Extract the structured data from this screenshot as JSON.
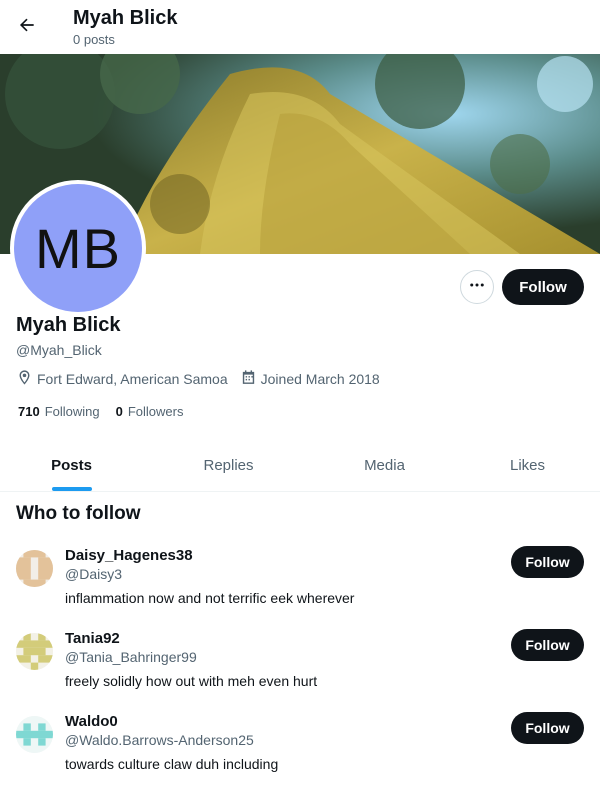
{
  "header": {
    "title": "Myah Blick",
    "post_count": "0 posts",
    "back_icon": "arrow-left-icon"
  },
  "profile": {
    "avatar_initials": "MB",
    "avatar_color": "#8fa0f8",
    "display_name": "Myah Blick",
    "handle": "@Myah_Blick",
    "location": "Fort Edward, American Samoa",
    "joined": "Joined March 2018",
    "following_count": "710",
    "following_label": "Following",
    "followers_count": "0",
    "followers_label": "Followers",
    "follow_label": "Follow"
  },
  "tabs": [
    {
      "label": "Posts",
      "active": true
    },
    {
      "label": "Replies",
      "active": false
    },
    {
      "label": "Media",
      "active": false
    },
    {
      "label": "Likes",
      "active": false
    }
  ],
  "who_to_follow": {
    "title": "Who to follow",
    "items": [
      {
        "name": "Daisy_Hagenes38",
        "handle": "@Daisy3",
        "bio": "inflammation now and not terrific eek wherever",
        "follow_label": "Follow",
        "avatar_color": "#e3c29a"
      },
      {
        "name": "Tania92",
        "handle": "@Tania_Bahringer99",
        "bio": "freely solidly how out with meh even hurt",
        "follow_label": "Follow",
        "avatar_color": "#d3cc7a"
      },
      {
        "name": "Waldo0",
        "handle": "@Waldo.Barrows-Anderson25",
        "bio": "towards culture claw duh including",
        "follow_label": "Follow",
        "avatar_color": "#7fd8d3"
      }
    ]
  },
  "colors": {
    "accent": "#1d9bf0",
    "button_dark": "#0f1419",
    "secondary_text": "#536471"
  }
}
